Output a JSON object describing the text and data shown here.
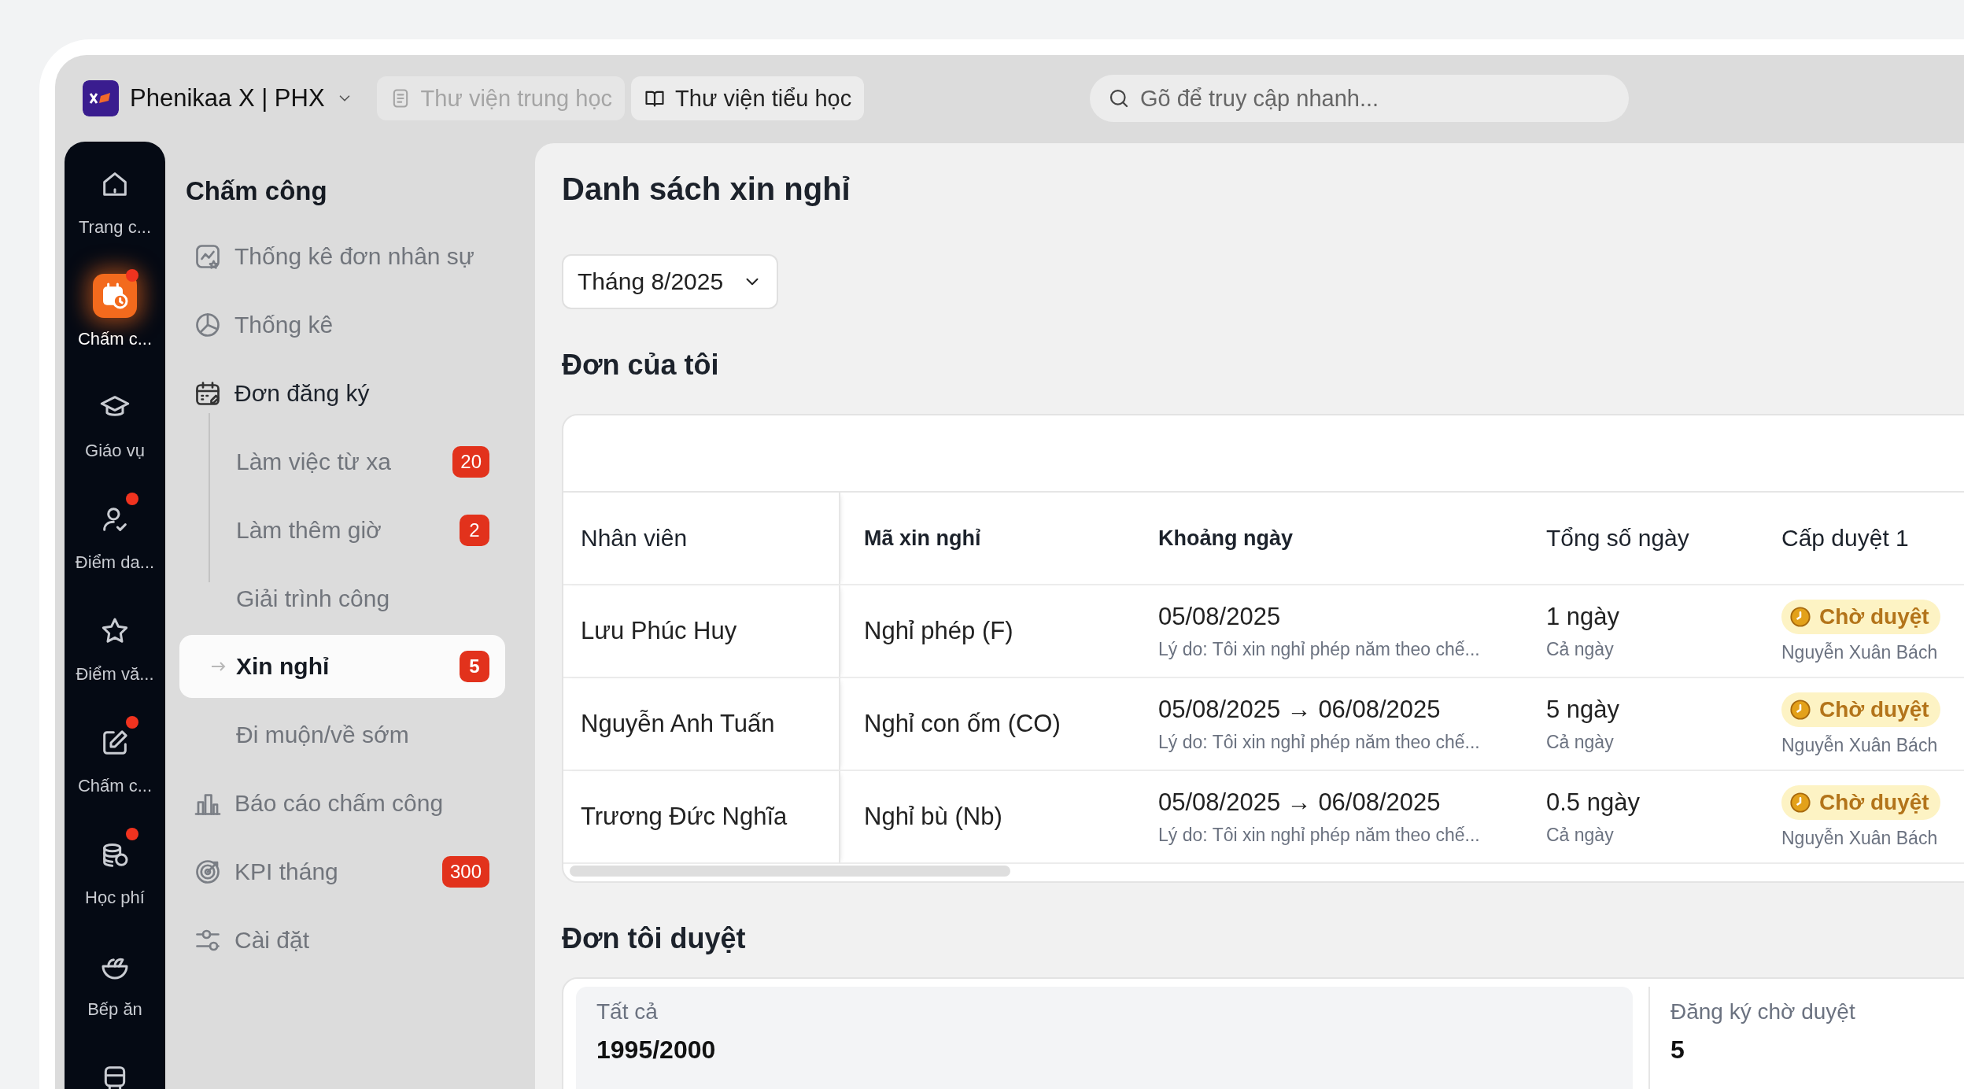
{
  "workspace": {
    "name": "Phenikaa X | PHX"
  },
  "libraries": [
    {
      "label": "Thư viện trung học",
      "disabled": true
    },
    {
      "label": "Thư viện tiểu học",
      "disabled": false
    }
  ],
  "search": {
    "placeholder": "Gõ để truy cập nhanh..."
  },
  "rail": [
    {
      "label": "Trang c...",
      "selected": false,
      "badge": false
    },
    {
      "label": "Chấm c...",
      "selected": true,
      "badge": true
    },
    {
      "label": "Giáo vụ",
      "selected": false,
      "badge": false
    },
    {
      "label": "Điểm da...",
      "selected": false,
      "badge": true
    },
    {
      "label": "Điểm vă...",
      "selected": false,
      "badge": false
    },
    {
      "label": "Chấm c...",
      "selected": false,
      "badge": true
    },
    {
      "label": "Học phí",
      "selected": false,
      "badge": true
    },
    {
      "label": "Bếp ăn",
      "selected": false,
      "badge": false
    },
    {
      "selected": false,
      "badge": false
    }
  ],
  "sidebar": {
    "title": "Chấm công",
    "items": [
      {
        "label": "Thống kê đơn nhân sự",
        "expanded": false
      },
      {
        "label": "Thống kê",
        "expanded": false
      },
      {
        "label": "Đơn đăng ký",
        "expanded": true,
        "children": [
          {
            "label": "Làm việc từ xa",
            "count": "20",
            "selected": false
          },
          {
            "label": "Làm thêm giờ",
            "count": "2",
            "selected": false
          },
          {
            "label": "Giải trình công",
            "selected": false
          },
          {
            "label": "Xin nghỉ",
            "count": "5",
            "selected": true
          },
          {
            "label": "Đi muộn/về sớm",
            "selected": false
          }
        ]
      },
      {
        "label": "Báo cáo chấm công",
        "expanded": false
      },
      {
        "label": "KPI tháng",
        "count": "300",
        "expanded": false
      },
      {
        "label": "Cài đặt",
        "expanded": false
      }
    ]
  },
  "page": {
    "title": "Danh sách xin nghỉ",
    "period": "Tháng 8/2025",
    "my_requests": {
      "title": "Đơn của tôi",
      "columns": [
        "Nhân viên",
        "Mã xin nghỉ",
        "Khoảng ngày",
        "Tổng số ngày",
        "Cấp duyệt 1"
      ],
      "rows": [
        {
          "employee": "Lưu Phúc Huy",
          "leave_type": "Nghỉ phép (F)",
          "date_range": "05/08/2025",
          "reason": "Lý do: Tôi xin nghỉ phép năm theo chế...",
          "total_days": "1 ngày",
          "day_part": "Cả ngày",
          "status": {
            "label": "Chờ duyệt",
            "kind": "pending"
          },
          "approver": "Nguyễn Xuân Bách"
        },
        {
          "employee": "Nguyễn Anh Tuấn",
          "leave_type": "Nghỉ con ốm (CO)",
          "date_range": "05/08/2025 → 06/08/2025",
          "reason": "Lý do: Tôi xin nghỉ phép năm theo chế...",
          "total_days": "5 ngày",
          "day_part": "Cả ngày",
          "status": {
            "label": "Chờ duyệt",
            "kind": "pending"
          },
          "approver": "Nguyễn Xuân Bách"
        },
        {
          "employee": "Trương Đức Nghĩa",
          "leave_type": "Nghỉ bù (Nb)",
          "date_range": "05/08/2025 → 06/08/2025",
          "reason": "Lý do: Tôi xin nghỉ phép năm theo chế...",
          "total_days": "0.5 ngày",
          "day_part": "Cả ngày",
          "status": {
            "label": "Chờ duyệt",
            "kind": "pending"
          },
          "approver": "Nguyễn Xuân Bách"
        }
      ]
    },
    "approvals": {
      "title": "Đơn tôi duyệt",
      "stats": [
        {
          "label": "Tất cả",
          "value": "1995/2000",
          "selected": true
        },
        {
          "label": "Đăng ký chờ duyệt",
          "value": "5",
          "selected": false
        }
      ]
    }
  }
}
